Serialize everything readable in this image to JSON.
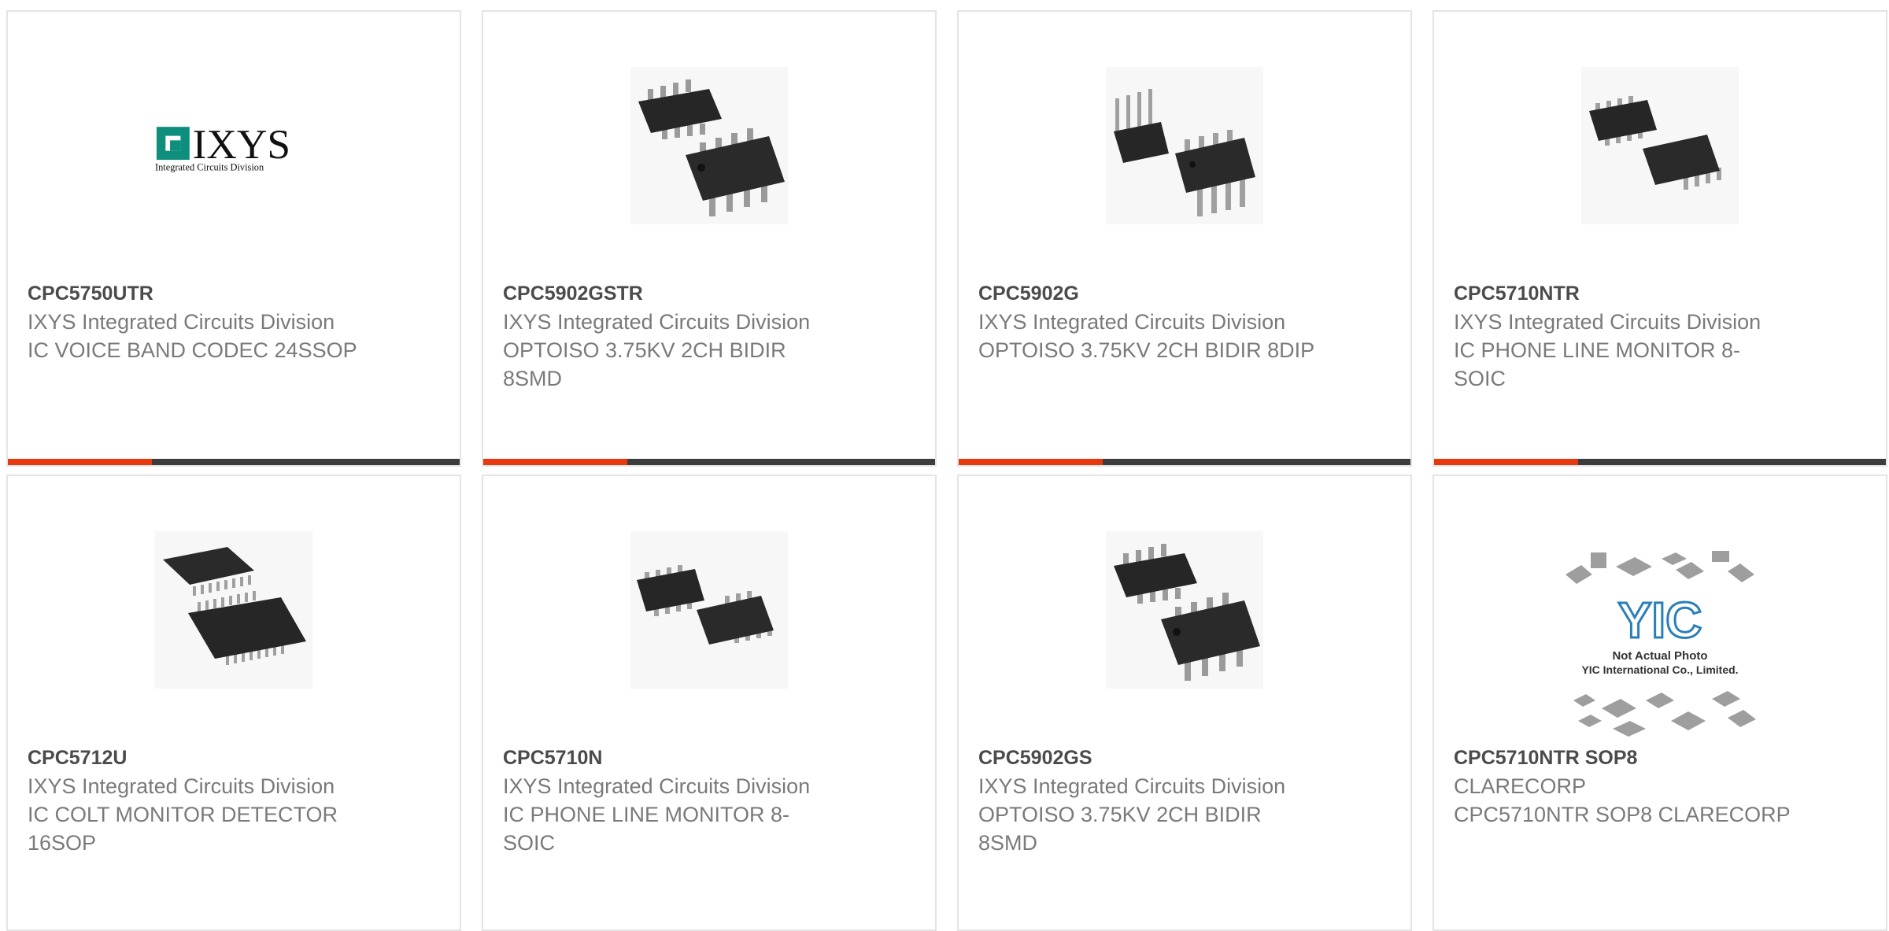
{
  "cards": [
    {
      "part": "CPC5750UTR",
      "manufacturer": "IXYS Integrated Circuits Division",
      "description": "IC VOICE BAND CODEC 24SSOP",
      "image": "ixys-logo",
      "logo_text": "IXYS",
      "logo_sub": "Integrated Circuits Division",
      "accent_color": "#e8390e"
    },
    {
      "part": "CPC5902GSTR",
      "manufacturer": "IXYS Integrated Circuits Division",
      "description": "OPTOISO 3.75KV 2CH BIDIR 8SMD",
      "image": "soic8-chip-pair-photo",
      "accent_color": "#e8390e"
    },
    {
      "part": "CPC5902G",
      "manufacturer": "IXYS Integrated Circuits Division",
      "description": "OPTOISO 3.75KV 2CH BIDIR 8DIP",
      "image": "dip8-chip-pair-photo",
      "accent_color": "#e8390e"
    },
    {
      "part": "CPC5710NTR",
      "manufacturer": "IXYS Integrated Circuits Division",
      "description": "IC PHONE LINE MONITOR 8-SOIC",
      "image": "soic8-chip-pair-photo",
      "accent_color": "#e8390e"
    },
    {
      "part": "CPC5712U",
      "manufacturer": "IXYS Integrated Circuits Division",
      "description": "IC COLT MONITOR DETECTOR 16SOP",
      "image": "sop16-chip-pair-photo"
    },
    {
      "part": "CPC5710N",
      "manufacturer": "IXYS Integrated Circuits Division",
      "description": "IC PHONE LINE MONITOR 8-SOIC",
      "image": "soic8-chip-pair-photo"
    },
    {
      "part": "CPC5902GS",
      "manufacturer": "IXYS Integrated Circuits Division",
      "description": "OPTOISO 3.75KV 2CH BIDIR 8SMD",
      "image": "soic8-chip-pair-photo"
    },
    {
      "part": "CPC5710NTR SOP8",
      "manufacturer": "CLARECORP",
      "description": "CPC5710NTR SOP8 CLARECORP",
      "image": "yic-placeholder",
      "placeholder_logo": "YIC",
      "placeholder_line1": "Not Actual Photo",
      "placeholder_line2": "YIC International Co., Limited."
    }
  ]
}
